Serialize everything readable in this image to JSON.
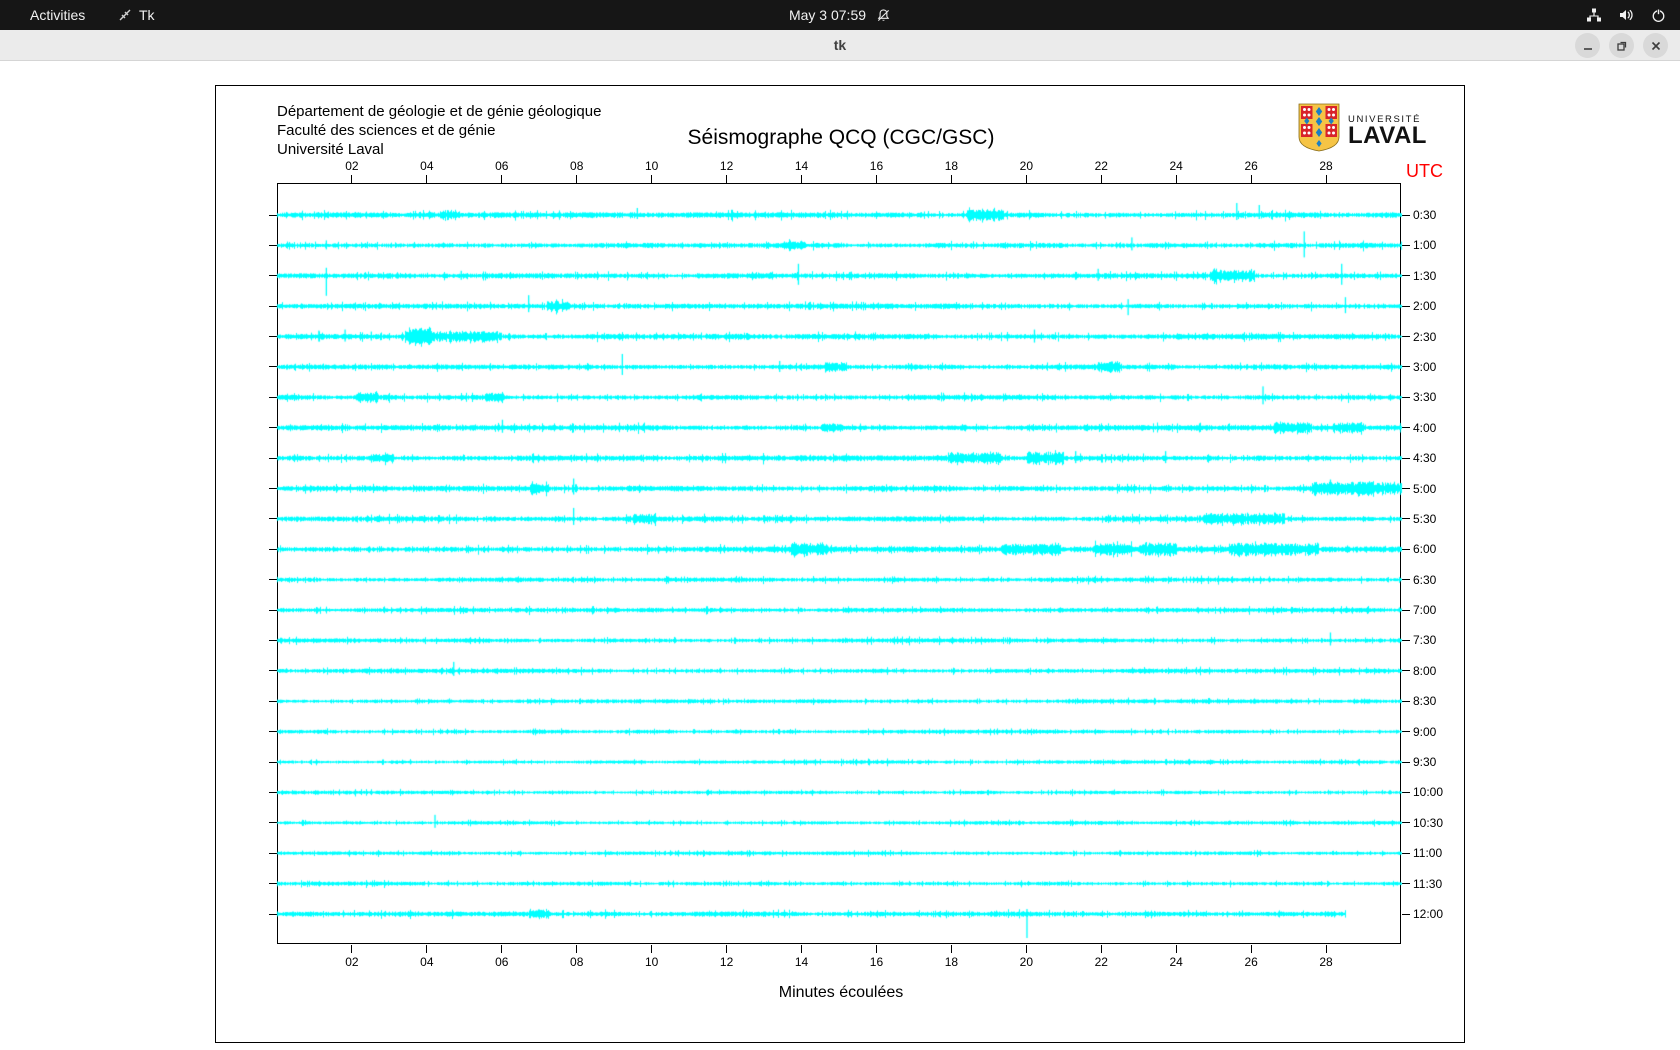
{
  "top_bar": {
    "activities_label": "Activities",
    "app_name": "Tk",
    "clock": "May 3  07:59",
    "icons": [
      "tk-icon",
      "notifications-disabled-icon",
      "network-wired-icon",
      "volume-icon",
      "power-icon"
    ]
  },
  "window": {
    "title": "tk",
    "buttons": [
      "minimize",
      "maximize",
      "close"
    ]
  },
  "seismograph": {
    "header_lines": "Département de géologie et de génie géologique\nFaculté des sciences et de génie\nUniversité Laval",
    "title": "Séismographe QCQ (CGC/GSC)",
    "utc_label": "UTC",
    "xlabel": "Minutes écoulées",
    "logo": {
      "line1": "UNIVERSITÉ",
      "line2": "LAVAL",
      "shield_gold": "#f6c445",
      "shield_red": "#d8232a",
      "shield_blue": "#1c7fc4"
    },
    "utc_color": "#ff0000"
  },
  "chart_data": {
    "type": "seismogram-helicorder",
    "title": "Séismographe QCQ (CGC/GSC)",
    "xlabel": "Minutes écoulées",
    "x_range_minutes": [
      0,
      30
    ],
    "x_ticks": [
      "02",
      "04",
      "06",
      "08",
      "10",
      "12",
      "14",
      "16",
      "18",
      "20",
      "22",
      "24",
      "26",
      "28"
    ],
    "trace_color": "#00ffff",
    "axis_color": "#000000",
    "trace_labels_utc": [
      "0:30",
      "1:00",
      "1:30",
      "2:00",
      "2:30",
      "3:00",
      "3:30",
      "4:00",
      "4:30",
      "5:00",
      "5:30",
      "6:00",
      "6:30",
      "7:00",
      "7:30",
      "8:00",
      "8:30",
      "9:00",
      "9:30",
      "10:00",
      "10:30",
      "11:00",
      "11:30",
      "12:00"
    ],
    "traces": [
      {
        "label": "0:30",
        "n": 1.5,
        "end": 30,
        "bursts": [
          [
            4.6,
            0.25,
            2.5
          ],
          [
            18.9,
            0.5,
            3.5
          ]
        ],
        "spikes": [
          [
            9.6,
            7,
            4
          ],
          [
            25.6,
            12,
            5
          ],
          [
            26.2,
            10,
            4
          ]
        ]
      },
      {
        "label": "1:00",
        "n": 1.4,
        "end": 30,
        "bursts": [
          [
            13.8,
            0.3,
            2
          ]
        ],
        "spikes": [
          [
            1.3,
            5,
            4
          ],
          [
            22.8,
            8,
            5
          ],
          [
            27.4,
            14,
            12
          ]
        ]
      },
      {
        "label": "1:30",
        "n": 1.4,
        "end": 30,
        "bursts": [
          [
            25.5,
            0.6,
            3.5
          ]
        ],
        "spikes": [
          [
            1.3,
            8,
            20
          ],
          [
            4.9,
            5,
            4
          ],
          [
            13.9,
            12,
            9
          ],
          [
            15.3,
            4,
            3
          ],
          [
            21.9,
            7,
            5
          ],
          [
            28.4,
            12,
            9
          ]
        ]
      },
      {
        "label": "2:00",
        "n": 1.4,
        "end": 30,
        "bursts": [
          [
            7.5,
            0.3,
            3
          ]
        ],
        "spikes": [
          [
            6.7,
            11,
            6
          ],
          [
            22.7,
            7,
            9
          ],
          [
            28.5,
            9,
            7
          ]
        ]
      },
      {
        "label": "2:30",
        "n": 1.5,
        "end": 30,
        "bursts": [
          [
            4.7,
            1.3,
            3
          ],
          [
            3.8,
            0.3,
            4
          ]
        ],
        "spikes": [
          [
            1.1,
            6,
            5
          ],
          [
            1.8,
            7,
            5
          ],
          [
            2.5,
            5,
            4
          ],
          [
            20.2,
            7,
            6
          ]
        ]
      },
      {
        "label": "3:00",
        "n": 1.4,
        "end": 30,
        "bursts": [
          [
            14.9,
            0.3,
            2.5
          ],
          [
            22.2,
            0.3,
            2.5
          ]
        ],
        "spikes": [
          [
            9.2,
            13,
            8
          ],
          [
            13.4,
            6,
            5
          ]
        ]
      },
      {
        "label": "3:30",
        "n": 1.4,
        "end": 30,
        "bursts": [
          [
            2.4,
            0.3,
            2.5
          ],
          [
            5.8,
            0.25,
            2.5
          ]
        ],
        "spikes": [
          [
            26.3,
            11,
            7
          ]
        ]
      },
      {
        "label": "4:00",
        "n": 1.5,
        "end": 30,
        "bursts": [
          [
            14.8,
            0.3,
            2
          ],
          [
            27.1,
            0.5,
            3.5
          ],
          [
            28.6,
            0.4,
            3
          ]
        ],
        "spikes": [
          [
            6.0,
            8,
            5
          ]
        ]
      },
      {
        "label": "4:30",
        "n": 1.5,
        "end": 30,
        "bursts": [
          [
            2.8,
            0.3,
            2
          ],
          [
            18.6,
            0.7,
            3
          ],
          [
            20.5,
            0.5,
            4
          ]
        ],
        "spikes": [
          [
            21.3,
            7,
            5
          ],
          [
            23.7,
            7,
            5
          ]
        ]
      },
      {
        "label": "5:00",
        "n": 1.5,
        "end": 30,
        "bursts": [
          [
            7.0,
            0.25,
            2.5
          ],
          [
            28.8,
            1.2,
            4
          ]
        ],
        "spikes": [
          [
            7.9,
            10,
            6
          ],
          [
            28.1,
            9,
            6
          ]
        ]
      },
      {
        "label": "5:30",
        "n": 1.5,
        "end": 30,
        "bursts": [
          [
            9.8,
            0.3,
            2.5
          ],
          [
            25.8,
            1.1,
            3.5
          ]
        ],
        "spikes": [
          [
            7.9,
            11,
            6
          ]
        ]
      },
      {
        "label": "6:00",
        "n": 1.6,
        "end": 30,
        "bursts": [
          [
            14.2,
            0.5,
            3.5
          ],
          [
            20.1,
            0.8,
            3
          ],
          [
            22.3,
            0.5,
            3
          ],
          [
            23.5,
            0.5,
            3.5
          ],
          [
            26.6,
            1.2,
            3.5
          ]
        ],
        "spikes": []
      },
      {
        "label": "6:30",
        "n": 1.2,
        "end": 30,
        "bursts": [],
        "spikes": []
      },
      {
        "label": "7:00",
        "n": 1.2,
        "end": 30,
        "bursts": [],
        "spikes": []
      },
      {
        "label": "7:30",
        "n": 1.2,
        "end": 30,
        "bursts": [],
        "spikes": [
          [
            28.1,
            8,
            5
          ]
        ]
      },
      {
        "label": "8:00",
        "n": 1.2,
        "end": 30,
        "bursts": [],
        "spikes": [
          [
            4.7,
            9,
            5
          ]
        ]
      },
      {
        "label": "8:30",
        "n": 1.1,
        "end": 30,
        "bursts": [],
        "spikes": []
      },
      {
        "label": "9:00",
        "n": 1.1,
        "end": 30,
        "bursts": [],
        "spikes": []
      },
      {
        "label": "9:30",
        "n": 1.0,
        "end": 30,
        "bursts": [],
        "spikes": []
      },
      {
        "label": "10:00",
        "n": 1.0,
        "end": 30,
        "bursts": [],
        "spikes": []
      },
      {
        "label": "10:30",
        "n": 1.0,
        "end": 30,
        "bursts": [],
        "spikes": [
          [
            4.2,
            8,
            5
          ]
        ]
      },
      {
        "label": "11:00",
        "n": 1.0,
        "end": 30,
        "bursts": [],
        "spikes": []
      },
      {
        "label": "11:30",
        "n": 1.1,
        "end": 30,
        "bursts": [],
        "spikes": []
      },
      {
        "label": "12:00",
        "n": 1.4,
        "end": 28.5,
        "bursts": [
          [
            7.0,
            0.3,
            3
          ]
        ],
        "spikes": [
          [
            20.0,
            5,
            24
          ]
        ]
      }
    ]
  }
}
